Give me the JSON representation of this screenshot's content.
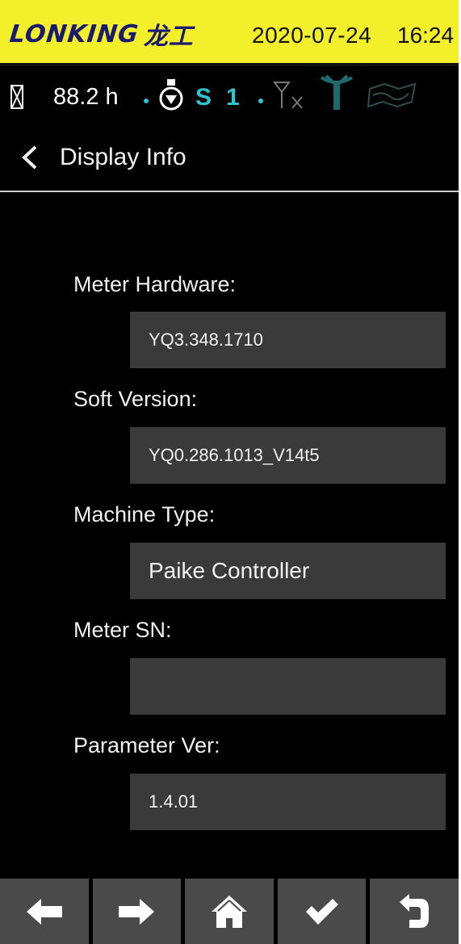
{
  "header": {
    "logo_latin": "LONKING",
    "logo_cn": "龙工",
    "date": "2020-07-24",
    "time": "16:24",
    "background_color": "#f3ef2a",
    "logo_color": "#1a1a73"
  },
  "status": {
    "hours": "88.2 h",
    "gear_letter": "S",
    "gear_number": "1",
    "accent_color": "#2ec5d3",
    "icons": [
      "hourglass-icon",
      "engine-icon",
      "no-signal-icon",
      "antenna-icon",
      "gps-map-icon"
    ]
  },
  "title_bar": {
    "title": "Display Info",
    "back_icon": "chevron-left-icon"
  },
  "fields": [
    {
      "label": "Meter Hardware:",
      "value": "YQ3.348.1710"
    },
    {
      "label": "Soft Version:",
      "value": "YQ0.286.1013_V14t5"
    },
    {
      "label": "Machine Type:",
      "value": "Paike Controller"
    },
    {
      "label": "Meter SN:",
      "value": ""
    },
    {
      "label": "Parameter Ver:",
      "value": "1.4.01"
    }
  ],
  "navbar": {
    "buttons": [
      "arrow-left-icon",
      "arrow-right-icon",
      "home-icon",
      "checkmark-icon",
      "return-icon"
    ]
  }
}
